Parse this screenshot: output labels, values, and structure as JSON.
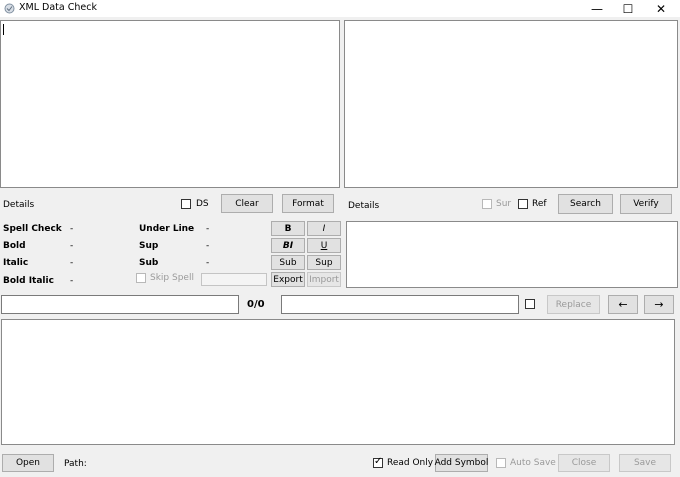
{
  "window": {
    "title": "XML Data Check",
    "minimize": "—",
    "maximize": "☐",
    "close": "✕"
  },
  "left_toolbar": {
    "details_label": "Details",
    "ds_label": "DS",
    "clear_label": "Clear",
    "format_label": "Format"
  },
  "right_toolbar": {
    "details_label": "Details",
    "sur_label": "Sur",
    "ref_label": "Ref",
    "search_label": "Search",
    "verify_label": "Verify"
  },
  "stats": {
    "spell_check": {
      "label": "Spell Check",
      "value": "-"
    },
    "bold": {
      "label": "Bold",
      "value": "-"
    },
    "italic": {
      "label": "Italic",
      "value": "-"
    },
    "bold_italic": {
      "label": "Bold Italic",
      "value": "-"
    },
    "under_line": {
      "label": "Under Line",
      "value": "-"
    },
    "sup": {
      "label": "Sup",
      "value": "-"
    },
    "sub": {
      "label": "Sub",
      "value": "-"
    },
    "skip_spell": "Skip Spell"
  },
  "format_buttons": {
    "b": "B",
    "i": "I",
    "bi": "BI",
    "u": "U",
    "sub": "Sub",
    "sup": "Sup",
    "export": "Export",
    "import": "Import"
  },
  "find": {
    "counter": "0/0",
    "replace_label": "Replace",
    "prev": "←",
    "next": "→"
  },
  "footer": {
    "open_label": "Open",
    "path_label": "Path:",
    "read_only_label": "Read Only",
    "read_only_checked": true,
    "add_symbol_label": "Add Symbol",
    "auto_save_label": "Auto Save",
    "close_label": "Close",
    "save_label": "Save"
  }
}
